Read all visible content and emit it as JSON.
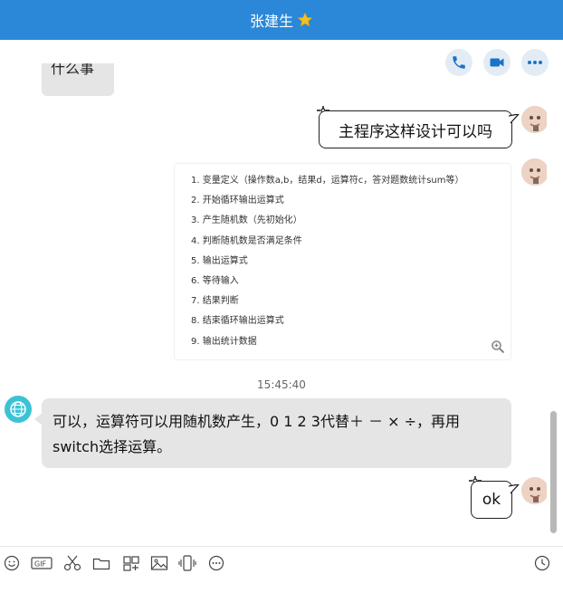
{
  "window": {
    "title": "张建生",
    "title_badge_icon": "star-icon"
  },
  "header_actions": [
    {
      "icon": "phone-icon"
    },
    {
      "icon": "video-call-icon"
    },
    {
      "icon": "more-icon"
    }
  ],
  "messages": {
    "partial_prev_text": "什么事",
    "question_text": "主程序这样设计可以吗",
    "image_lines": [
      "1. 变量定义（操作数a,b，结果d，运算符c，答对题数统计sum等）",
      "2. 开始循环输出运算式",
      "3. 产生随机数（先初始化）",
      "4. 判断随机数是否满足条件",
      "5. 输出运算式",
      "6. 等待输入",
      "7. 结果判断",
      "8. 结束循环输出运算式",
      "9. 输出统计数据"
    ],
    "timestamp": "15:45:40",
    "reply_text": "可以，运算符可以用随机数产生，0 1 2 3代替＋ － × ÷，再用switch选择运算。",
    "ok_text": "ok"
  },
  "toolbar": [
    {
      "icon": "emoji-icon"
    },
    {
      "icon": "gif-icon",
      "label": "GIF"
    },
    {
      "icon": "scissors-icon"
    },
    {
      "icon": "folder-icon"
    },
    {
      "icon": "screenshot-icon"
    },
    {
      "icon": "image-icon"
    },
    {
      "icon": "phone-shake-icon"
    },
    {
      "icon": "more-circle-icon"
    },
    {
      "icon": "history-clock-icon"
    }
  ],
  "colors": {
    "accent": "#2b88d8",
    "bubble_gray": "#e5e5e5",
    "round_button_bg": "#e3ecf5",
    "icon_blue": "#1a73c9"
  }
}
